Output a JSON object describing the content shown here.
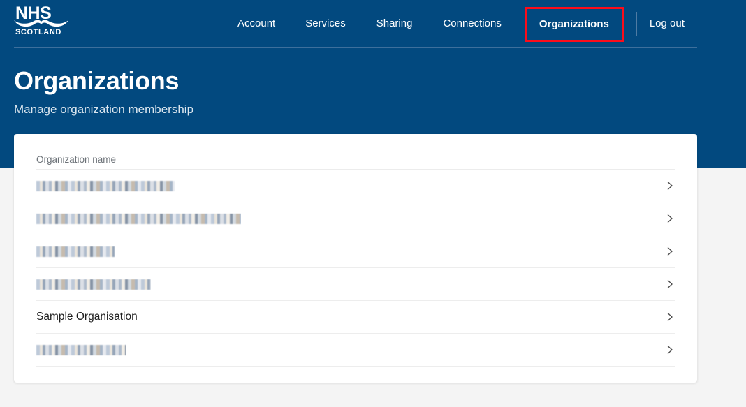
{
  "brand": {
    "logo_primary": "NHS",
    "logo_secondary": "SCOTLAND",
    "logo_icon": "nhs-scotland-logo"
  },
  "colors": {
    "header_blue": "#02497f",
    "highlight_red": "#fc0d1b",
    "page_background": "#f4f4f4",
    "card_white": "#ffffff"
  },
  "nav": {
    "items": [
      {
        "label": "Account",
        "active": false
      },
      {
        "label": "Services",
        "active": false
      },
      {
        "label": "Sharing",
        "active": false
      },
      {
        "label": "Connections",
        "active": false
      },
      {
        "label": "Organizations",
        "active": true
      }
    ],
    "logout_label": "Log out"
  },
  "page": {
    "title": "Organizations",
    "subtitle": "Manage organization membership"
  },
  "table": {
    "column_header": "Organization name",
    "rows": [
      {
        "name": "",
        "redacted": true,
        "chevron": "chevron-right-icon"
      },
      {
        "name": "",
        "redacted": true,
        "chevron": "chevron-right-icon"
      },
      {
        "name": "",
        "redacted": true,
        "chevron": "chevron-right-icon"
      },
      {
        "name": "",
        "redacted": true,
        "chevron": "chevron-right-icon"
      },
      {
        "name": "Sample Organisation",
        "redacted": false,
        "chevron": "chevron-right-icon"
      },
      {
        "name": "",
        "redacted": true,
        "chevron": "chevron-right-icon"
      }
    ]
  }
}
